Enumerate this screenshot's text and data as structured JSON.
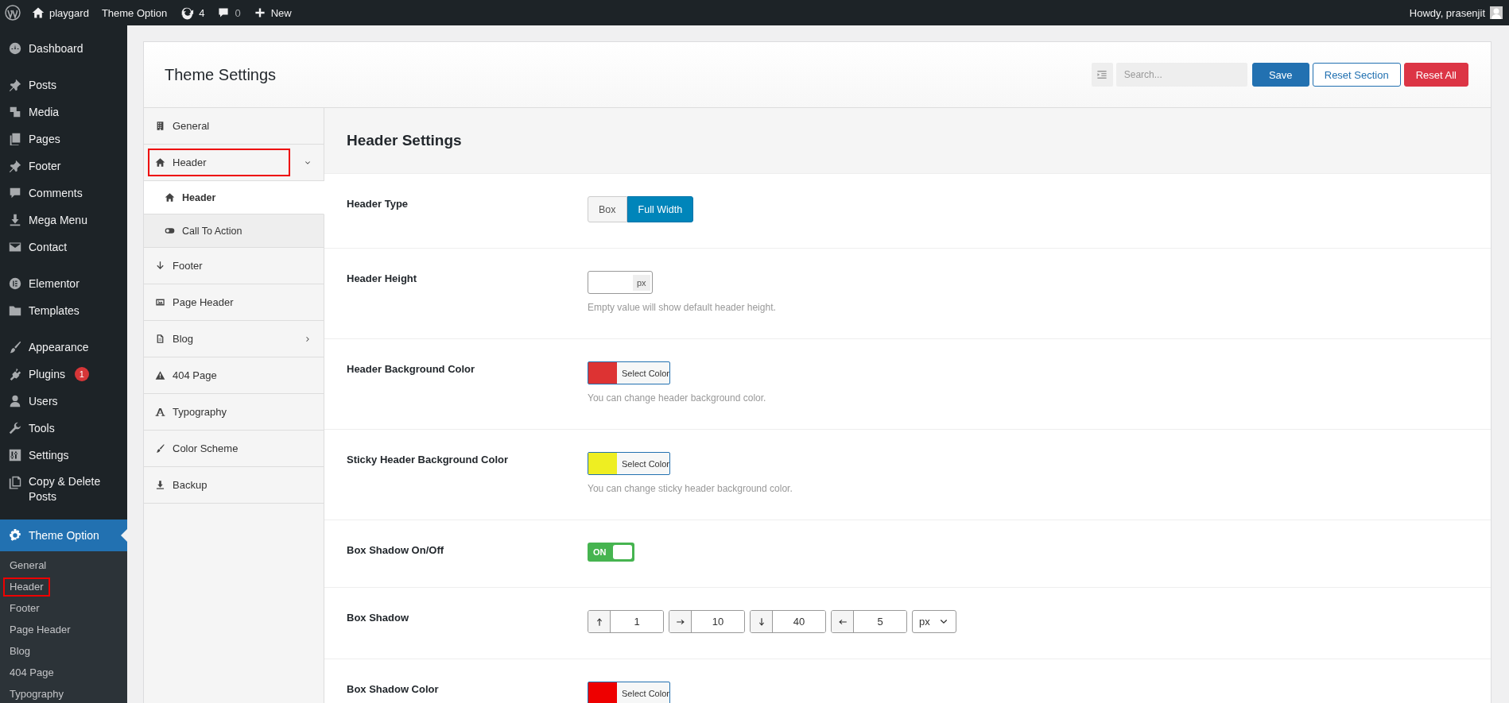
{
  "admin_bar": {
    "site": "playgard",
    "menu": "Theme Option",
    "updates": "4",
    "comments": "0",
    "new": "New",
    "greeting": "Howdy, prasenjit"
  },
  "sidebar": {
    "groups": [
      [
        {
          "label": "Dashboard",
          "selected": false
        }
      ],
      [
        {
          "label": "Posts",
          "selected": false
        },
        {
          "label": "Media",
          "selected": false
        },
        {
          "label": "Pages",
          "selected": false
        },
        {
          "label": "Footer",
          "selected": false
        },
        {
          "label": "Comments",
          "selected": false
        },
        {
          "label": "Mega Menu",
          "selected": false
        },
        {
          "label": "Contact",
          "selected": false
        }
      ],
      [
        {
          "label": "Elementor",
          "selected": false
        },
        {
          "label": "Templates",
          "selected": false
        }
      ],
      [
        {
          "label": "Appearance",
          "selected": false
        },
        {
          "label": "Plugins",
          "badge": "1",
          "selected": false
        },
        {
          "label": "Users",
          "selected": false
        },
        {
          "label": "Tools",
          "selected": false
        },
        {
          "label": "Settings",
          "selected": false
        },
        {
          "label": "Copy & Delete Posts",
          "selected": false
        }
      ],
      [
        {
          "label": "Theme Option",
          "selected": true,
          "submenu": [
            {
              "label": "General",
              "highlighted": false
            },
            {
              "label": "Header",
              "highlighted": true
            },
            {
              "label": "Footer",
              "highlighted": false
            },
            {
              "label": "Page Header",
              "highlighted": false
            },
            {
              "label": "Blog",
              "highlighted": false
            },
            {
              "label": "404 Page",
              "highlighted": false
            },
            {
              "label": "Typography",
              "highlighted": false
            }
          ]
        }
      ]
    ]
  },
  "panel": {
    "title": "Theme Settings",
    "search": {
      "placeholder": "Search..."
    },
    "buttons": [
      {
        "kind": "primary",
        "label": "Save"
      },
      {
        "kind": "outline",
        "label": "Reset Section"
      },
      {
        "kind": "danger",
        "label": "Reset All"
      }
    ],
    "nav": [
      {
        "label": "General",
        "selected": false,
        "highlighted": false
      },
      {
        "label": "Header",
        "selected": false,
        "highlighted": true,
        "expanded": true,
        "children": [
          {
            "label": "Header",
            "selected": true
          },
          {
            "label": "Call To Action",
            "selected": false
          }
        ]
      },
      {
        "label": "Footer",
        "selected": false,
        "highlighted": false
      },
      {
        "label": "Page Header",
        "selected": false,
        "highlighted": false
      },
      {
        "label": "Blog",
        "selected": false,
        "highlighted": false,
        "expanded": false
      },
      {
        "label": "404 Page",
        "selected": false,
        "highlighted": false
      },
      {
        "label": "Typography",
        "selected": false,
        "highlighted": false
      },
      {
        "label": "Color Scheme",
        "selected": false,
        "highlighted": false
      },
      {
        "label": "Backup",
        "selected": false,
        "highlighted": false
      }
    ],
    "section_title": "Header Settings",
    "fields": [
      {
        "kind": "buttonset",
        "label": "Header Type",
        "options": [
          {
            "label": "Box",
            "selected": false
          },
          {
            "label": "Full Width",
            "selected": true
          }
        ]
      },
      {
        "kind": "dimension",
        "label": "Header Height",
        "unit": "px",
        "description": "Empty value will show default header height."
      },
      {
        "kind": "color",
        "label": "Header Background Color",
        "color": "#dd3333",
        "button": "Select Color",
        "description": "You can change header background color."
      },
      {
        "kind": "color",
        "label": "Sticky Header Background Color",
        "color": "#eeee22",
        "button": "Select Color",
        "description": "You can change sticky header background color."
      },
      {
        "kind": "switch",
        "label": "Box Shadow On/Off",
        "on": true,
        "state_text": "ON"
      },
      {
        "kind": "spacing",
        "label": "Box Shadow",
        "inputs": [
          {
            "value": "1"
          },
          {
            "value": "10"
          },
          {
            "value": "40"
          },
          {
            "value": "5"
          }
        ],
        "unit": "px"
      },
      {
        "kind": "color",
        "label": "Box Shadow Color",
        "color": "#ee0000",
        "button": "Select Color"
      }
    ]
  }
}
